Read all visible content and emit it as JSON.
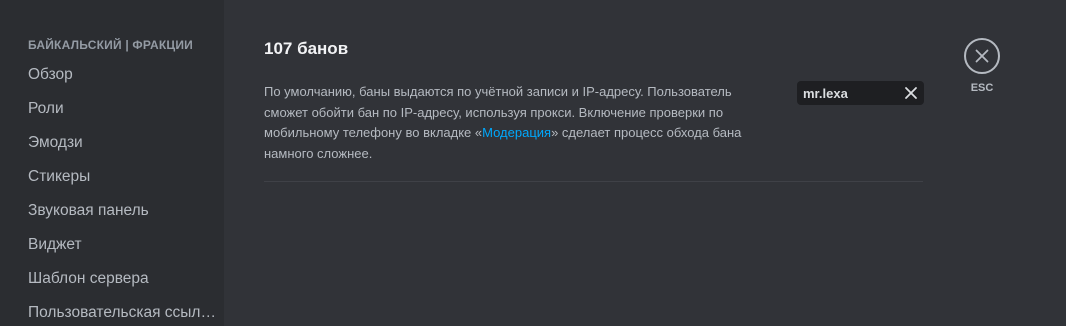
{
  "sidebar": {
    "header": "БАЙКАЛЬСКИЙ | ФРАКЦИИ",
    "items": [
      {
        "label": "Обзор"
      },
      {
        "label": "Роли"
      },
      {
        "label": "Эмодзи"
      },
      {
        "label": "Стикеры"
      },
      {
        "label": "Звуковая панель"
      },
      {
        "label": "Виджет"
      },
      {
        "label": "Шаблон сервера"
      },
      {
        "label": "Пользовательская ссылка"
      }
    ]
  },
  "main": {
    "title": "107 банов",
    "description_before": "По умолчанию, баны выдаются по учётной записи и IP-адресу. Пользователь сможет обойти бан по IP-адресу, используя прокси. Включение проверки по мобильному телефону во вкладке «",
    "description_link": "Модерация",
    "description_after": "» сделает процесс обхода бана намного сложнее.",
    "search": {
      "value": "mr.lexa",
      "clear_icon": "close-icon"
    }
  },
  "close": {
    "icon": "close-icon",
    "label": "ESC"
  },
  "colors": {
    "background": "#313338",
    "sidebar": "#2b2d31",
    "link": "#00a8fc",
    "text_muted": "#b5bac1",
    "text_header": "#f2f3f5"
  }
}
